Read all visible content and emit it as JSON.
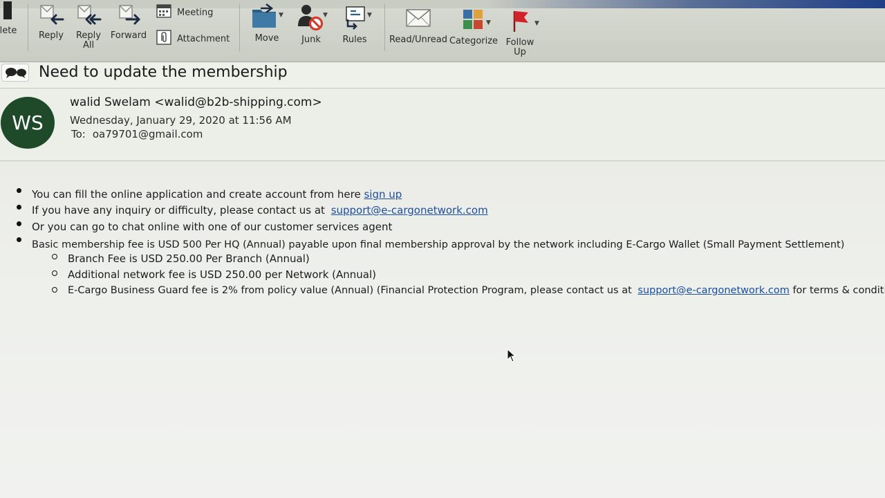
{
  "toolbar": {
    "delete_label": "lete",
    "reply_label": "Reply",
    "reply_all_label_1": "Reply",
    "reply_all_label_2": "All",
    "forward_label": "Forward",
    "meeting_label": "Meeting",
    "attachment_label": "Attachment",
    "move_label": "Move",
    "junk_label": "Junk",
    "rules_label": "Rules",
    "read_unread_label": "Read/Unread",
    "categorize_label": "Categorize",
    "follow_up_label_1": "Follow",
    "follow_up_label_2": "Up"
  },
  "message": {
    "subject": "Need to update the membership",
    "avatar_initials": "WS",
    "sender": "walid Swelam <walid@b2b-shipping.com>",
    "date": "Wednesday, January 29, 2020 at 11:56 AM",
    "to_label": "To:",
    "to_value": "oa79701@gmail.com"
  },
  "body": {
    "b1_text": "You can fill the online application and create account from here",
    "b1_link": "sign up",
    "b2_text": "If you have any inquiry or difficulty, please contact us at",
    "b2_link": "support@e-cargonetwork.com",
    "b3_text": "Or you can go to chat online with one of our customer services agent",
    "b4_text": "Basic membership fee is USD 500 Per HQ (Annual) payable upon final membership approval by the network including E-Cargo Wallet (Small Payment Settlement)",
    "s1_text": "Branch Fee is USD 250.00 Per Branch (Annual)",
    "s2_text": "Additional network fee is USD 250.00 per Network (Annual)",
    "s3_text": "E-Cargo Business Guard fee is 2% from policy value (Annual) (Financial Protection Program, please contact us at",
    "s3_link": "support@e-cargonetwork.com",
    "s3_tail": "for terms & conditions)"
  },
  "icons": {
    "delete": "trash-icon",
    "reply": "reply-icon",
    "reply_all": "reply-all-icon",
    "forward": "forward-icon",
    "meeting": "calendar-icon",
    "attachment": "paperclip-icon",
    "move": "folder-move-icon",
    "junk": "junk-icon",
    "rules": "rules-icon",
    "read_unread": "envelope-icon",
    "categorize": "category-grid-icon",
    "follow_up": "flag-icon"
  },
  "colors": {
    "avatar_bg": "#1e4a2a",
    "link": "#1c4ea0",
    "flag": "#d2232a",
    "junk": "#d33b2e"
  }
}
